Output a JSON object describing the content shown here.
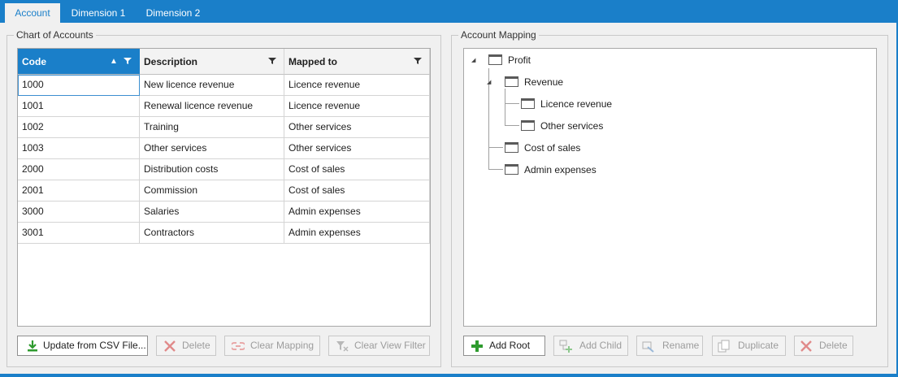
{
  "tabs": [
    {
      "label": "Account",
      "active": true
    },
    {
      "label": "Dimension 1",
      "active": false
    },
    {
      "label": "Dimension 2",
      "active": false
    }
  ],
  "chart_of_accounts": {
    "title": "Chart of Accounts",
    "columns": [
      "Code",
      "Description",
      "Mapped to"
    ],
    "rows": [
      {
        "code": "1000",
        "description": "New licence revenue",
        "mapped_to": "Licence revenue"
      },
      {
        "code": "1001",
        "description": "Renewal licence revenue",
        "mapped_to": "Licence revenue"
      },
      {
        "code": "1002",
        "description": "Training",
        "mapped_to": "Other services"
      },
      {
        "code": "1003",
        "description": "Other services",
        "mapped_to": "Other services"
      },
      {
        "code": "2000",
        "description": "Distribution costs",
        "mapped_to": "Cost of sales"
      },
      {
        "code": "2001",
        "description": "Commission",
        "mapped_to": "Cost of sales"
      },
      {
        "code": "3000",
        "description": "Salaries",
        "mapped_to": "Admin expenses"
      },
      {
        "code": "3001",
        "description": "Contractors",
        "mapped_to": "Admin expenses"
      }
    ],
    "buttons": {
      "update_csv": "Update from CSV File...",
      "delete": "Delete",
      "clear_mapping": "Clear Mapping",
      "clear_view_filter": "Clear View Filter"
    }
  },
  "account_mapping": {
    "title": "Account Mapping",
    "tree": {
      "root": "Profit",
      "revenue": "Revenue",
      "licence_revenue": "Licence revenue",
      "other_services": "Other services",
      "cost_of_sales": "Cost of sales",
      "admin_expenses": "Admin expenses"
    },
    "buttons": {
      "add_root": "Add Root",
      "add_child": "Add Child",
      "rename": "Rename",
      "duplicate": "Duplicate",
      "delete": "Delete"
    }
  },
  "colors": {
    "accent": "#1a7fc9",
    "add_green": "#2e9b2e",
    "delete_red": "#d03838"
  }
}
